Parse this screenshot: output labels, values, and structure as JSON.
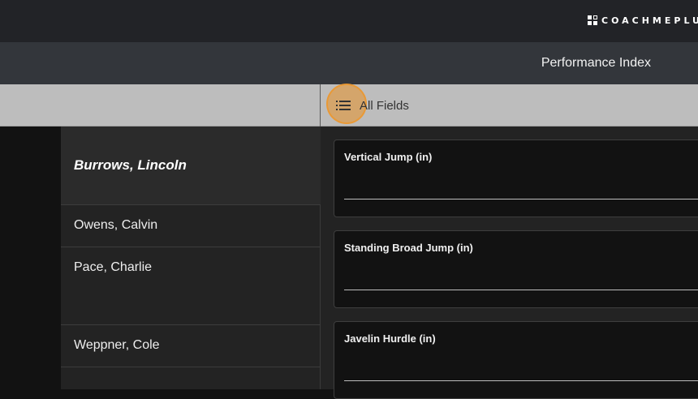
{
  "brand": {
    "logo_text": "COACHMEPLUS"
  },
  "header": {
    "title": "Performance Index"
  },
  "filter": {
    "label": "All Fields",
    "icon": "list-icon"
  },
  "athletes": [
    {
      "name": "Burrows, Lincoln",
      "selected": true
    },
    {
      "name": "Owens, Calvin",
      "selected": false
    },
    {
      "name": "Pace, Charlie",
      "selected": false
    },
    {
      "name": "Weppner, Cole",
      "selected": false
    }
  ],
  "fields": [
    {
      "label": "Vertical Jump (in)",
      "value": ""
    },
    {
      "label": "Standing Broad Jump (in)",
      "value": ""
    },
    {
      "label": "Javelin Hurdle (in)",
      "value": ""
    }
  ],
  "colors": {
    "accent_highlight": "#e8912b",
    "filter_bar": "#bdbdbd"
  }
}
